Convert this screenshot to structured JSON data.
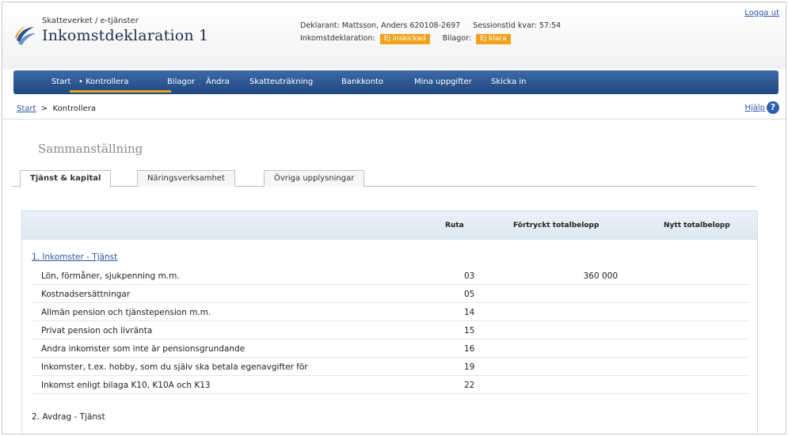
{
  "header": {
    "brand_small": "Skatteverket / e-tjänster",
    "title": "Inkomstdeklaration 1",
    "declarant_label": "Deklarant:",
    "declarant_value": "Mattsson, Anders 620108-2697",
    "session_label": "Sessionstid kvar:",
    "session_value": "57:54",
    "declaration_label": "Inkomstdeklaration:",
    "declaration_status": "Ej inskickad",
    "attachments_label": "Bilagor:",
    "attachments_status": "Ej klara",
    "logout": "Logga ut"
  },
  "nav": {
    "items": [
      "Start",
      "• Kontrollera",
      "Bilagor",
      "Ändra",
      "Skatteuträkning",
      "Bankkonto",
      "Mina uppgifter",
      "Skicka in"
    ],
    "active_index": 1
  },
  "breadcrumb": {
    "home": "Start",
    "separator": ">",
    "current": "Kontrollera"
  },
  "help": "Hjälp",
  "section_title": "Sammanställning",
  "tabs": [
    "Tjänst & kapital",
    "Näringsverksamhet",
    "Övriga upplysningar"
  ],
  "table": {
    "headers": {
      "ruta": "Ruta",
      "prefilled": "Förtryckt totalbelopp",
      "new": "Nytt totalbelopp"
    },
    "group1": "1. Inkomster - Tjänst",
    "rows": [
      {
        "label": "Lön, förmåner, sjukpenning m.m.",
        "ruta": "03",
        "prefilled": "360 000"
      },
      {
        "label": "Kostnadsersättningar",
        "ruta": "05",
        "prefilled": ""
      },
      {
        "label": "Allmän pension och tjänstepension m.m.",
        "ruta": "14",
        "prefilled": ""
      },
      {
        "label": "Privat pension och livränta",
        "ruta": "15",
        "prefilled": ""
      },
      {
        "label": "Andra inkomster som inte är pensionsgrundande",
        "ruta": "16",
        "prefilled": ""
      },
      {
        "label": "Inkomster, t.ex. hobby, som du själv ska betala egenavgifter för",
        "ruta": "19",
        "prefilled": ""
      },
      {
        "label": "Inkomst enligt bilaga K10, K10A och K13",
        "ruta": "22",
        "prefilled": ""
      }
    ],
    "group2": "2. Avdrag - Tjänst"
  },
  "colors": {
    "nav_blue": "#2a548f",
    "accent_orange": "#f1a21c",
    "link_blue": "#2e55a5"
  }
}
